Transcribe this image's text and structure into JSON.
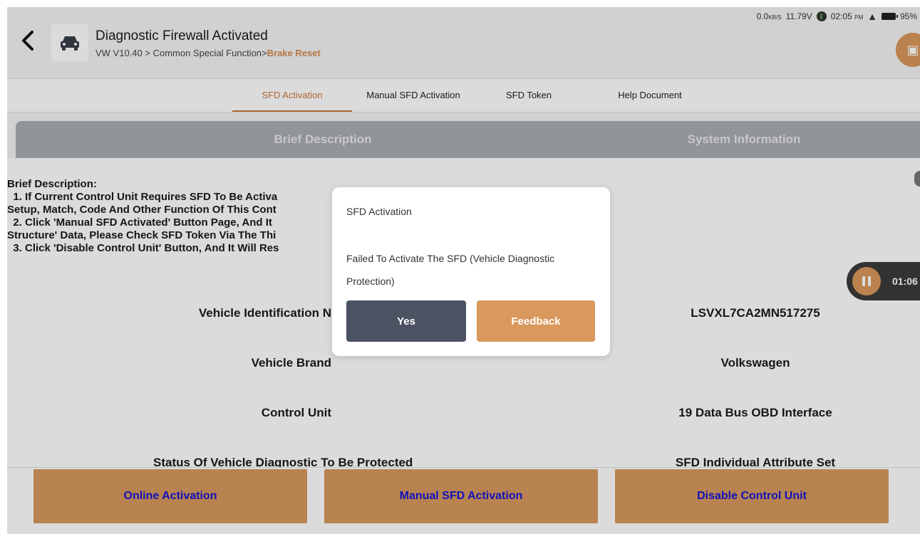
{
  "status_bar": {
    "net_speed": "0.0",
    "net_unit": "KB/S",
    "voltage": "11.79V",
    "time": "02:05",
    "ampm": "PM",
    "battery": "95%"
  },
  "header": {
    "title": "Diagnostic Firewall Activated",
    "path_prefix": "VW V10.40 > Common Special Function>",
    "path_highlight": "Brake Reset"
  },
  "tabs": [
    {
      "label": "SFD Activation",
      "active": true
    },
    {
      "label": "Manual SFD Activation",
      "active": false
    },
    {
      "label": "SFD Token",
      "active": false
    },
    {
      "label": "Help Document",
      "active": false
    }
  ],
  "table_header": {
    "left": "Brief Description",
    "right": "System Information"
  },
  "description": {
    "title": "Brief Description:",
    "lines": [
      "  1. If Current Control Unit Requires SFD To Be Activa",
      "Setup, Match, Code And Other Function Of This Cont",
      "  2. Click 'Manual SFD Activated' Button Page, And It",
      "Structure' Data, Please Check SFD Token Via The Thi",
      "  3. Click 'Disable Control Unit' Button, And It Will Res"
    ]
  },
  "info_rows": [
    {
      "label": "Vehicle Identification N",
      "value": "LSVXL7CA2MN517275"
    },
    {
      "label": "Vehicle Brand",
      "value": "Volkswagen"
    },
    {
      "label": "Control Unit",
      "value": "19 Data Bus OBD Interface"
    },
    {
      "label": "Status Of Vehicle Diagnostic To Be Protected",
      "value": "SFD Individual Attribute Set"
    }
  ],
  "timer": "01:06",
  "footer_buttons": {
    "online": "Online Activation",
    "manual": "Manual SFD Activation",
    "disable": "Disable Control Unit"
  },
  "dialog": {
    "title": "SFD Activation",
    "message": "Failed To Activate The SFD (Vehicle Diagnostic Protection)",
    "yes": "Yes",
    "feedback": "Feedback"
  },
  "colors": {
    "accent": "#d9985c",
    "tab_active": "#c9773d",
    "footer_button": "#d7995f",
    "footer_text": "#1515d8",
    "dialog_yes": "#4b5261",
    "table_header": "#a9adb2"
  }
}
